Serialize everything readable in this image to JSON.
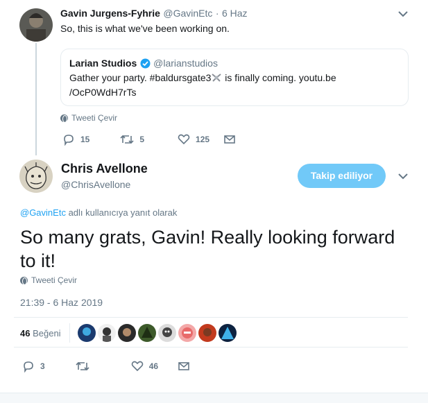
{
  "parent_tweet": {
    "author_name": "Gavin Jurgens-Fyhrie",
    "author_handle": "@GavinEtc",
    "separator": "·",
    "date": "6 Haz",
    "text": "So, this is what we've been working on.",
    "quoted": {
      "author_name": "Larian Studios",
      "author_handle": "@larianstudios",
      "line1": "Gather your party. #baldursgate3",
      "line1_after": " is finally coming. youtu.be",
      "line2": "/OcP0WdH7rTs"
    },
    "translate_label": "Tweeti Çevir",
    "replies": "15",
    "retweets": "5",
    "likes": "125"
  },
  "main_tweet": {
    "author_name": "Chris Avellone",
    "author_handle": "@ChrisAvellone",
    "follow_label": "Takip ediliyor",
    "reply_to_handle": "@GavinEtc",
    "reply_to_suffix": " adlı kullanıcıya yanıt olarak",
    "text_line1": "So many grats, Gavin! Really looking forward",
    "text_line2": "to it!",
    "translate_label": "Tweeti Çevir",
    "timestamp": "21:39 - 6 Haz 2019",
    "likes_count": "46",
    "likes_label": "Beğeni",
    "replies": "3",
    "retweets": "",
    "likes": "46"
  },
  "colors": {
    "accent": "#1da1f2",
    "follow_button": "#71c9f8",
    "muted": "#657786",
    "divider": "#e6ecf0"
  }
}
